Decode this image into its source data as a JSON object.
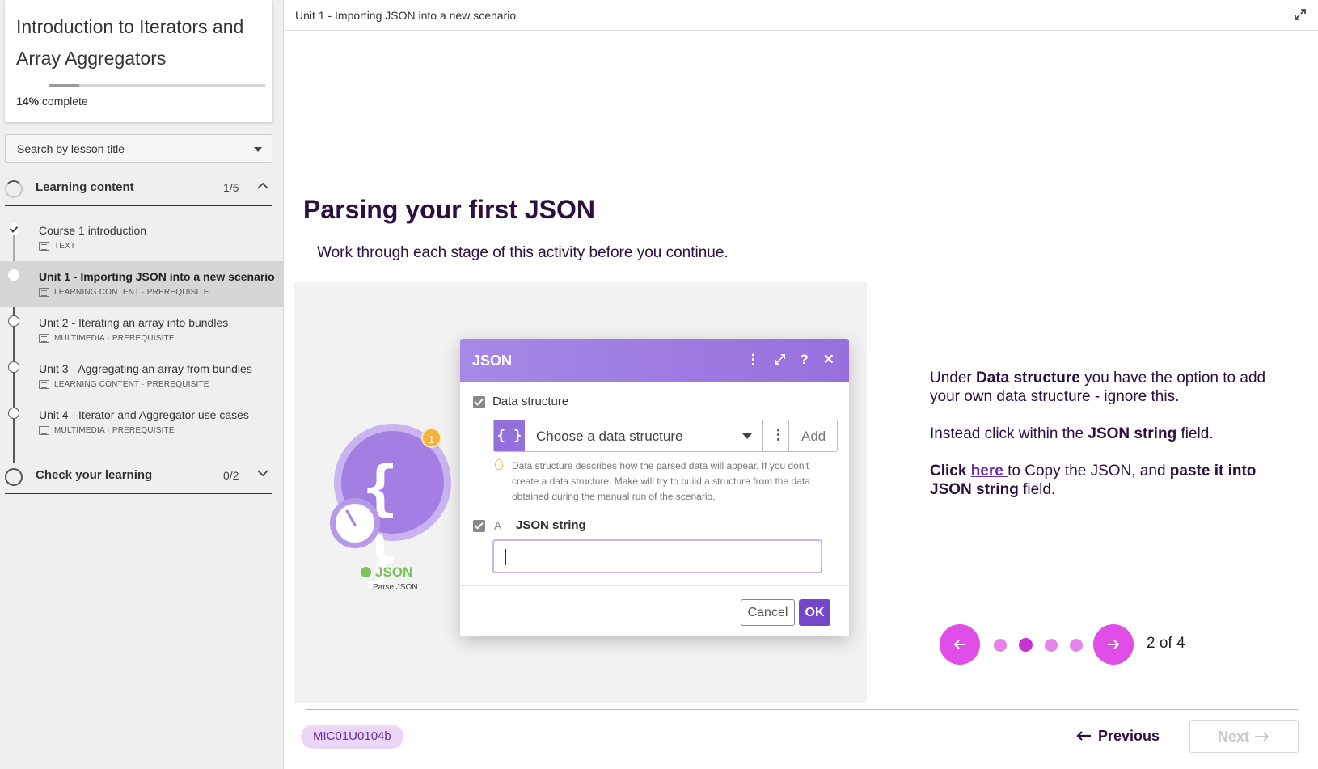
{
  "course": {
    "title": "Introduction to Iterators and Array Aggregators",
    "progress_percent": "14%",
    "progress_suffix": "complete",
    "progress_fraction": 0.14
  },
  "search": {
    "placeholder": "Search by lesson title"
  },
  "sections": [
    {
      "label": "Learning content",
      "count": "1/5",
      "expanded": true
    },
    {
      "label": "Check your learning",
      "count": "0/2",
      "expanded": false
    }
  ],
  "lessons": [
    {
      "title": "Course 1 introduction",
      "meta": "TEXT",
      "state": "done"
    },
    {
      "title": "Unit 1 - Importing JSON into a new scenario",
      "meta": "LEARNING CONTENT · PREREQUISITE",
      "state": "current"
    },
    {
      "title": "Unit 2 - Iterating an array into bundles",
      "meta": "MULTIMEDIA · PREREQUISITE",
      "state": "todo"
    },
    {
      "title": "Unit 3 - Aggregating an array from bundles",
      "meta": "LEARNING CONTENT · PREREQUISITE",
      "state": "todo"
    },
    {
      "title": "Unit 4 - Iterator and Aggregator use cases",
      "meta": "MULTIMEDIA · PREREQUISITE",
      "state": "todo"
    }
  ],
  "topbar": {
    "breadcrumb": "Unit 1 - Importing JSON into a new scenario"
  },
  "slide": {
    "title": "Parsing your first JSON",
    "subtitle": "Work through each stage of this activity before you continue."
  },
  "screenshot": {
    "modal_title": "JSON",
    "data_structure_label": "Data structure",
    "choose_placeholder": "Choose a data structure",
    "add_label": "Add",
    "hint": "Data structure describes how the parsed data will appear. If you don't create a data structure, Make will try to build a structure from the data obtained during the manual run of the scenario.",
    "json_string_type": "A",
    "json_string_label": "JSON string",
    "json_string_value": "",
    "cancel_label": "Cancel",
    "ok_label": "OK",
    "badge_name": "JSON",
    "badge_sub": "Parse JSON",
    "badge_count": "1",
    "badge_glyph": "{ }",
    "field_glyph": "{ }"
  },
  "instructions": {
    "p1_a": "Under ",
    "p1_b": "Data structure",
    "p1_c": " you have the option to add your own data structure - ignore this.",
    "p2_a": "Instead click within the ",
    "p2_b": "JSON string",
    "p2_c": " field.",
    "p3_a": "Click ",
    "p3_link": "here ",
    "p3_b": "to Copy the JSON, and ",
    "p3_c": "paste it into JSON string",
    "p3_d": " field."
  },
  "carousel": {
    "current": 2,
    "total": 4,
    "label": "2 of 4"
  },
  "footer": {
    "code": "MIC01U0104b",
    "previous_label": "Previous",
    "next_label": "Next"
  },
  "colors": {
    "accent": "#e14ee7",
    "brand_purple": "#9470dc",
    "heading": "#2a0f3f"
  }
}
